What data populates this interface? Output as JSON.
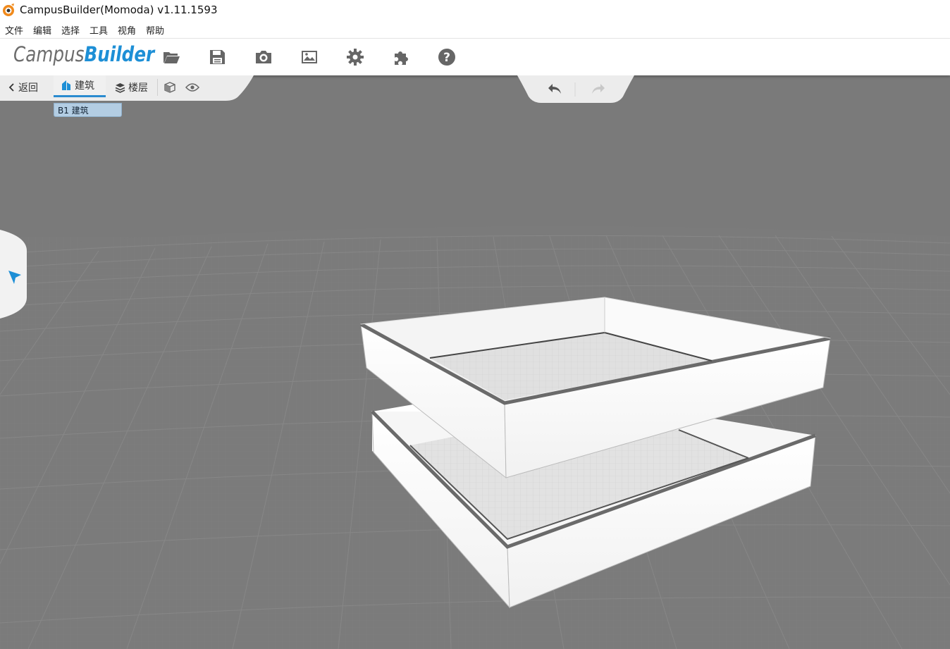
{
  "window": {
    "title": "CampusBuilder(Momoda) v1.11.1593"
  },
  "menu": [
    "文件",
    "编辑",
    "选择",
    "工具",
    "视角",
    "帮助"
  ],
  "brand": {
    "part1": "Campus",
    "part2": "Builder"
  },
  "toolbar": {
    "buttons": [
      {
        "icon": "folder-open-icon"
      },
      {
        "icon": "save-icon"
      },
      {
        "icon": "camera-icon"
      },
      {
        "icon": "image-icon"
      },
      {
        "icon": "gear-icon"
      },
      {
        "icon": "puzzle-icon"
      },
      {
        "icon": "help-icon"
      }
    ]
  },
  "subbar": {
    "back_label": "返回",
    "building_label": "建筑",
    "floor_label": "楼层"
  },
  "dropdown": {
    "item": "B1  建筑"
  },
  "colors": {
    "accent": "#1d8fd6",
    "ground": "#7b7b7b",
    "selection": "#b3cde3"
  }
}
